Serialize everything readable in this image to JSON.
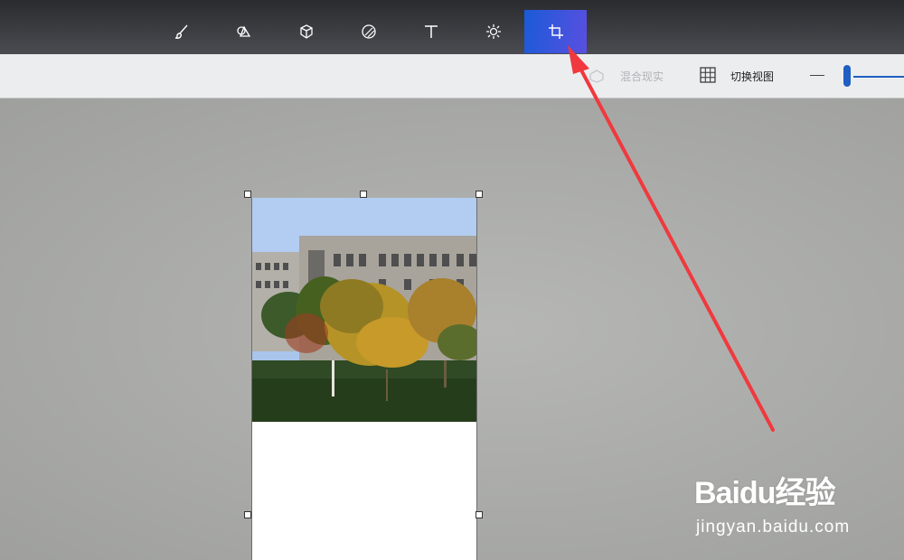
{
  "toolbar": {
    "tools": [
      {
        "name": "brushes",
        "icon": "brush-icon"
      },
      {
        "name": "2d-shapes",
        "icon": "2d-shapes-icon"
      },
      {
        "name": "3d-shapes",
        "icon": "3d-cube-icon"
      },
      {
        "name": "stickers",
        "icon": "sticker-icon"
      },
      {
        "name": "text",
        "icon": "text-icon"
      },
      {
        "name": "effects",
        "icon": "effects-sun-icon"
      },
      {
        "name": "canvas",
        "icon": "crop-canvas-icon",
        "active": true
      }
    ],
    "active_color": "#3a55dc"
  },
  "subbar": {
    "mixed_reality_label": "混合现实",
    "switch_view_label": "切换视图"
  },
  "watermark": {
    "brand": "Baidu经验",
    "url": "jingyan.baidu.com"
  },
  "annotation": {
    "arrow_color": "#f0393e"
  }
}
